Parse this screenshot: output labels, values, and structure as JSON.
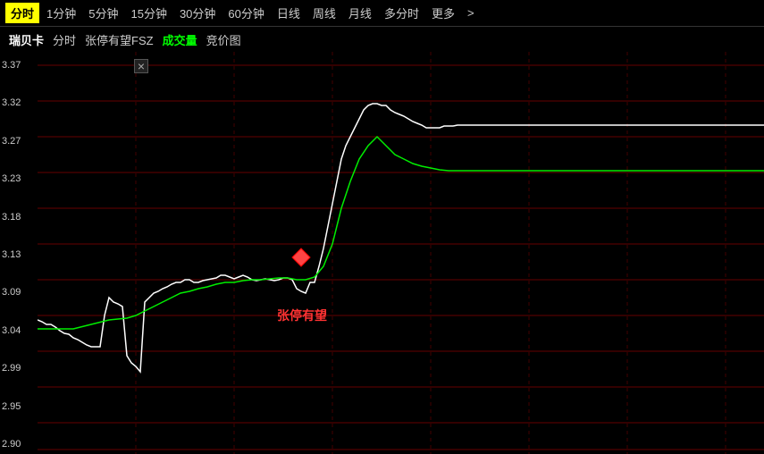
{
  "topbar": {
    "items": [
      {
        "label": "分时",
        "active": true
      },
      {
        "label": "1分钟",
        "active": false
      },
      {
        "label": "5分钟",
        "active": false
      },
      {
        "label": "15分钟",
        "active": false
      },
      {
        "label": "30分钟",
        "active": false
      },
      {
        "label": "60分钟",
        "active": false
      },
      {
        "label": "日线",
        "active": false
      },
      {
        "label": "周线",
        "active": false
      },
      {
        "label": "月线",
        "active": false
      },
      {
        "label": "多分时",
        "active": false
      },
      {
        "label": "更多",
        "active": false
      },
      {
        "label": ">",
        "active": false
      }
    ]
  },
  "subheader": {
    "brand": "瑞贝卡",
    "items": [
      {
        "label": "分时",
        "style": "normal"
      },
      {
        "label": "张停有望FSZ",
        "style": "normal"
      },
      {
        "label": "成交量",
        "style": "green"
      },
      {
        "label": "竞价图",
        "style": "normal"
      }
    ]
  },
  "chart": {
    "price_levels": [
      "3.37",
      "3.32",
      "3.27",
      "3.23",
      "3.18",
      "3.13",
      "3.09",
      "3.04",
      "2.99",
      "2.95",
      "2.90"
    ],
    "annotation": "张停有望",
    "close_button": "×"
  }
}
